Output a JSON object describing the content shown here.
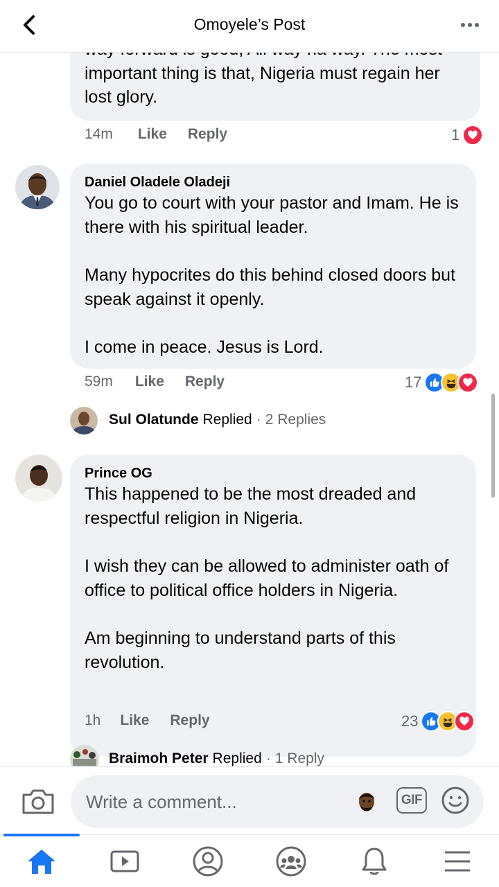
{
  "header": {
    "title": "Omoyele’s Post"
  },
  "comments": [
    {
      "text": "way forward is good,  All way na way. The most important thing is that, Nigeria must regain her lost glory.",
      "time": "14m",
      "like_label": "Like",
      "reply_label": "Reply",
      "reaction_count": "1",
      "reactions": [
        "love"
      ]
    },
    {
      "author": "Daniel Oladele Oladeji",
      "text": "You go to court with your pastor and Imam. He is there with his spiritual leader.\n\nMany hypocrites do this behind closed doors but speak against it openly.\n\nI come in peace. Jesus is Lord.",
      "time": "59m",
      "like_label": "Like",
      "reply_label": "Reply",
      "reaction_count": "17",
      "reactions": [
        "like",
        "haha",
        "love"
      ],
      "replies": {
        "name": "Sul Olatunde",
        "replied_label": "Replied",
        "separator": "·",
        "count_label": "2 Replies"
      }
    },
    {
      "author": "Prince OG",
      "text": "This happened to be the most dreaded and respectful religion in Nigeria.\n\nI wish they can be allowed to administer oath of office to political office holders in Nigeria.\n\nAm beginning to understand parts of this revolution.",
      "time": "1h",
      "like_label": "Like",
      "reply_label": "Reply",
      "reaction_count": "23",
      "reactions": [
        "like",
        "haha",
        "love"
      ],
      "replies": {
        "name": "Braimoh Peter",
        "replied_label": "Replied",
        "separator": "·",
        "count_label": "1 Reply"
      }
    }
  ],
  "composer": {
    "placeholder": "Write a comment...",
    "gif_label": "GIF"
  },
  "tabbar": {
    "items": [
      "home-icon",
      "watch-icon",
      "profile-icon",
      "groups-icon",
      "notifications-icon",
      "menu-icon"
    ],
    "active": "home-icon"
  },
  "colors": {
    "accent": "#1877f2",
    "bubble": "#eff1f5",
    "secondary_text": "#65676b",
    "love": "#f0284a",
    "haha": "#f7c132"
  }
}
